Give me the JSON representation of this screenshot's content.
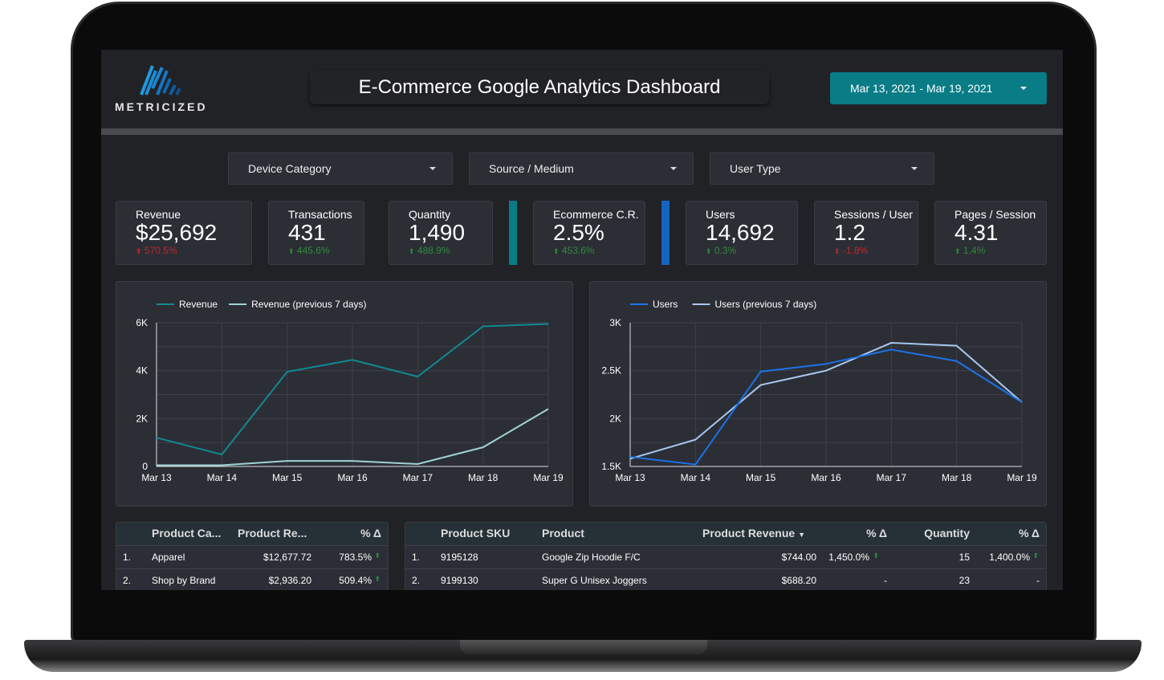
{
  "brand": {
    "name": "METRICIZED"
  },
  "header": {
    "title": "E-Commerce Google Analytics Dashboard",
    "date_range": "Mar 13, 2021 - Mar 19, 2021"
  },
  "filters": [
    {
      "label": "Device Category"
    },
    {
      "label": "Source / Medium"
    },
    {
      "label": "User Type"
    }
  ],
  "kpis": [
    {
      "label": "Revenue",
      "value": "$25,692",
      "change": "570.5%",
      "dir": "up",
      "color": "down"
    },
    {
      "label": "Transactions",
      "value": "431",
      "change": "445.6%",
      "dir": "up",
      "color": "up"
    },
    {
      "label": "Quantity",
      "value": "1,490",
      "change": "488.9%",
      "dir": "up",
      "color": "up"
    },
    {
      "label": "Ecommerce C.R.",
      "value": "2.5%",
      "change": "453.6%",
      "dir": "up",
      "color": "up"
    },
    {
      "label": "Users",
      "value": "14,692",
      "change": "0.3%",
      "dir": "up",
      "color": "up"
    },
    {
      "label": "Sessions / User",
      "value": "1.2",
      "change": "-1.8%",
      "dir": "down",
      "color": "down"
    },
    {
      "label": "Pages / Session",
      "value": "4.31",
      "change": "1.4%",
      "dir": "up",
      "color": "up"
    }
  ],
  "colors": {
    "teal": "#0a7c86",
    "blue": "#1565c0",
    "up": "#2e8b3a",
    "down": "#c0262d"
  },
  "chart_data": [
    {
      "type": "line",
      "categories": [
        "Mar 13",
        "Mar 14",
        "Mar 15",
        "Mar 16",
        "Mar 17",
        "Mar 18",
        "Mar 19"
      ],
      "ylim": [
        0,
        6000
      ],
      "yticks": [
        "0",
        "2K",
        "4K",
        "6K"
      ],
      "ytick_values": [
        0,
        2000,
        4000,
        6000
      ],
      "grid": true,
      "legend": "top-left",
      "series": [
        {
          "name": "Revenue",
          "color": "#0f8a92",
          "values": [
            1200,
            500,
            3950,
            4450,
            3750,
            5850,
            5950
          ]
        },
        {
          "name": "Revenue (previous 7 days)",
          "color": "#9fd3d6",
          "values": [
            50,
            50,
            230,
            230,
            100,
            800,
            2400
          ]
        }
      ]
    },
    {
      "type": "line",
      "categories": [
        "Mar 13",
        "Mar 14",
        "Mar 15",
        "Mar 16",
        "Mar 17",
        "Mar 18",
        "Mar 19"
      ],
      "ylim": [
        1500,
        3000
      ],
      "yticks": [
        "1.5K",
        "2K",
        "2.5K",
        "3K"
      ],
      "ytick_values": [
        1500,
        2000,
        2500,
        3000
      ],
      "grid": true,
      "legend": "top-left",
      "series": [
        {
          "name": "Users",
          "color": "#1a73e8",
          "values": [
            1600,
            1520,
            2490,
            2570,
            2720,
            2600,
            2170
          ]
        },
        {
          "name": "Users (previous 7 days)",
          "color": "#a8c8f0",
          "values": [
            1580,
            1780,
            2350,
            2500,
            2790,
            2760,
            2170
          ]
        }
      ]
    }
  ],
  "category_table": {
    "headers": [
      "Product Ca...",
      "Product Re...",
      "% Δ"
    ],
    "rows": [
      {
        "n": "1.",
        "cat": "Apparel",
        "rev": "$12,677.72",
        "pct": "783.5%"
      },
      {
        "n": "2.",
        "cat": "Shop by Brand",
        "rev": "$2,936.20",
        "pct": "509.4%"
      }
    ]
  },
  "product_table": {
    "headers": [
      "Product SKU",
      "Product",
      "Product Revenue",
      "% Δ",
      "Quantity",
      "% Δ"
    ],
    "rows": [
      {
        "n": "1.",
        "sku": "9195128",
        "prod": "Google Zip Hoodie F/C",
        "rev": "$744.00",
        "pct": "1,450.0%",
        "qty": "15",
        "qpct": "1,400.0%"
      },
      {
        "n": "2.",
        "sku": "9199130",
        "prod": "Super G Unisex Joggers",
        "rev": "$688.20",
        "pct": "-",
        "qty": "23",
        "qpct": "-"
      }
    ]
  }
}
